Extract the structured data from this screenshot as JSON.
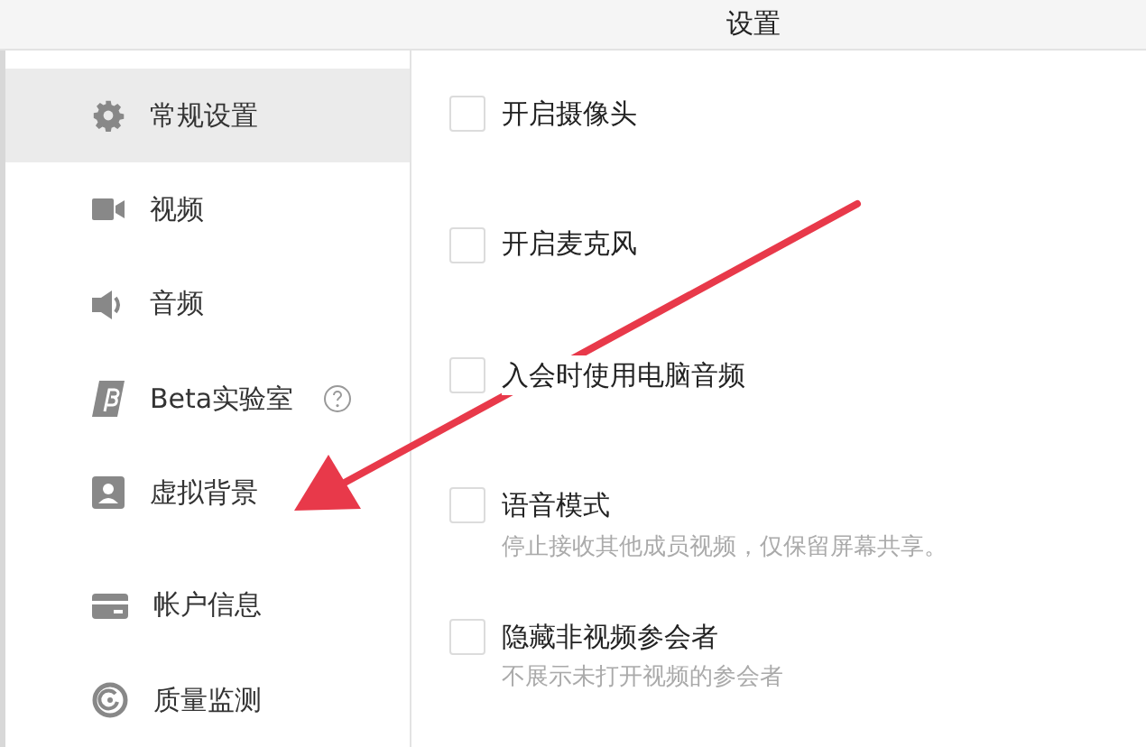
{
  "window": {
    "title": "设置"
  },
  "sidebar": {
    "items": [
      {
        "label": "常规设置",
        "kind": "gear",
        "selected": true
      },
      {
        "label": "视频",
        "kind": "camera",
        "selected": false
      },
      {
        "label": "音频",
        "kind": "speaker",
        "selected": false
      },
      {
        "label": "Beta实验室",
        "kind": "beta",
        "selected": false,
        "help": true
      },
      {
        "label": "虚拟背景",
        "kind": "person",
        "selected": false
      },
      {
        "label": "帐户信息",
        "kind": "card",
        "selected": false,
        "group_start": true
      },
      {
        "label": "质量监测",
        "kind": "gauge",
        "selected": false
      }
    ]
  },
  "options": [
    {
      "label": "开启摄像头",
      "checked": false
    },
    {
      "label": "开启麦克风",
      "checked": false
    },
    {
      "label": "入会时使用电脑音频",
      "checked": false
    },
    {
      "label": "语音模式",
      "checked": false,
      "description": "停止接收其他成员视频，仅保留屏幕共享。"
    },
    {
      "label": "隐藏非视频参会者",
      "checked": false,
      "description": "不展示未打开视频的参会者"
    }
  ],
  "annotation": {
    "kind": "arrow"
  }
}
